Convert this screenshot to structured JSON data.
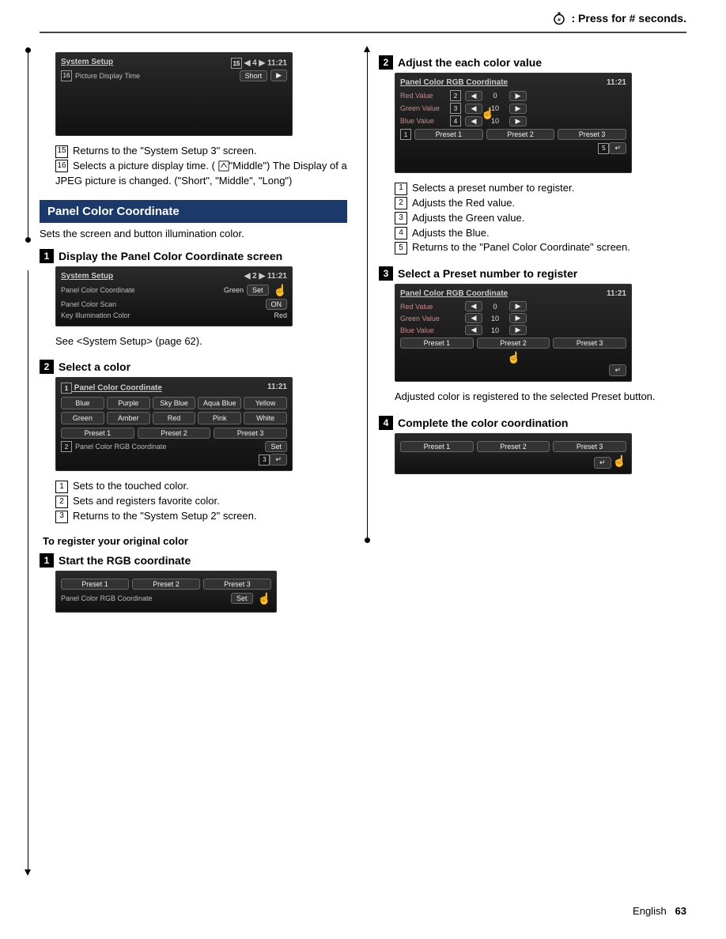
{
  "header": {
    "press_text": ": Press for # seconds."
  },
  "left": {
    "screenshot1": {
      "title": "System Setup",
      "tab_num": "15",
      "page": "4",
      "time": "11:21",
      "row_num": "16",
      "row_label": "Picture Display Time",
      "row_value": "Short"
    },
    "desc1": [
      {
        "n": "15",
        "t": "Returns to the \"System Setup 3\" screen."
      },
      {
        "n": "16",
        "t": "Selects a picture display time. ( "
      },
      {
        "n": "",
        "t": "\"Middle\") The Display of a JPEG picture is changed. (\"Short\", \"Middle\", \"Long\")"
      }
    ],
    "section_title": "Panel Color Coordinate",
    "section_desc": "Sets the screen and button illumination color.",
    "step1_title": "Display the Panel Color Coordinate screen",
    "screenshot2": {
      "title": "System Setup",
      "page": "2",
      "time": "11:21",
      "rows": [
        {
          "label": "Panel Color Coordinate",
          "value": "Green",
          "btn": "Set"
        },
        {
          "label": "Panel Color Scan",
          "value": "",
          "btn": "ON"
        },
        {
          "label": "Key Illumination Color",
          "value": "Red",
          "btn": ""
        }
      ]
    },
    "see_text": "See <System Setup> (page 62).",
    "step2_title": "Select a color",
    "screenshot3": {
      "title": "Panel Color Coordinate",
      "time": "11:21",
      "tag": "1",
      "colors": [
        "Blue",
        "Purple",
        "Sky Blue",
        "Aqua Blue",
        "Yellow",
        "Green",
        "Amber",
        "Red",
        "Pink",
        "White"
      ],
      "presets": [
        "Preset 1",
        "Preset 2",
        "Preset 3"
      ],
      "rgb_tag": "2",
      "rgb_label": "Panel Color RGB Coordinate",
      "set_btn": "Set",
      "back_tag": "3"
    },
    "desc3": [
      {
        "n": "1",
        "t": "Sets to the touched color."
      },
      {
        "n": "2",
        "t": "Sets and registers favorite color."
      },
      {
        "n": "3",
        "t": "Returns to the \"System Setup 2\" screen."
      }
    ],
    "sub_title": "To register your original color",
    "step_rgb_title": "Start the RGB coordinate",
    "screenshot4": {
      "presets": [
        "Preset 1",
        "Preset 2",
        "Preset 3"
      ],
      "label": "Panel Color RGB Coordinate",
      "btn": "Set"
    }
  },
  "right": {
    "step2_title": "Adjust the each color value",
    "screenshot5": {
      "title": "Panel Color RGB Coordinate",
      "time": "11:21",
      "rows": [
        {
          "label": "Red Value",
          "n": "2",
          "v": "0"
        },
        {
          "label": "Green Value",
          "n": "3",
          "v": "10"
        },
        {
          "label": "Blue Value",
          "n": "4",
          "v": "10"
        }
      ],
      "preset_tag": "1",
      "presets": [
        "Preset 1",
        "Preset 2",
        "Preset 3"
      ],
      "back_tag": "5"
    },
    "desc5": [
      {
        "n": "1",
        "t": "Selects a preset number to register."
      },
      {
        "n": "2",
        "t": "Adjusts the Red value."
      },
      {
        "n": "3",
        "t": "Adjusts the Green value."
      },
      {
        "n": "4",
        "t": "Adjusts the Blue."
      },
      {
        "n": "5",
        "t": "Returns to the \"Panel Color Coordinate\" screen."
      }
    ],
    "step3_title": "Select a Preset number to register",
    "screenshot6": {
      "title": "Panel Color RGB Coordinate",
      "time": "11:21",
      "rows": [
        {
          "label": "Red Value",
          "v": "0"
        },
        {
          "label": "Green Value",
          "v": "10"
        },
        {
          "label": "Blue Value",
          "v": "10"
        }
      ],
      "presets": [
        "Preset 1",
        "Preset 2",
        "Preset 3"
      ]
    },
    "desc6": "Adjusted color is registered to the selected Preset button.",
    "step4_title": "Complete the color coordination",
    "screenshot7": {
      "presets": [
        "Preset 1",
        "Preset 2",
        "Preset 3"
      ]
    }
  },
  "footer": {
    "lang": "English",
    "page": "63"
  }
}
